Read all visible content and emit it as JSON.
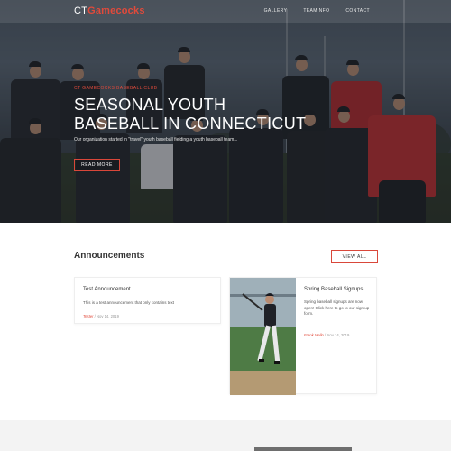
{
  "brand": {
    "prefix": "CT",
    "name": "Gamecocks"
  },
  "nav": {
    "links": [
      "GALLERY",
      "TEAMINFO",
      "CONTACT"
    ]
  },
  "hero": {
    "kicker": "CT GAMECOCKS BASEBALL CLUB",
    "title": "SEASONAL YOUTH BASEBALL IN CONNECTICUT",
    "description": "Our organization started in \"travel\" youth baseball fielding a youth baseball team...",
    "cta": "READ MORE"
  },
  "announcements": {
    "heading": "Announcements",
    "view_all": "VIEW ALL",
    "items": [
      {
        "title": "Test Announcement",
        "body": "This is a test announcement that only contains text",
        "author": "Tester",
        "date": "Nov 14, 2019"
      },
      {
        "title": "Spring Baseball Signups",
        "body": "Spring baseball signups are now open! Click here to go to our sign up form.",
        "author": "Frank Mello",
        "date": "Nov 14, 2019"
      }
    ]
  },
  "colors": {
    "accent": "#e14a3b",
    "hero_overlay": "#191c22"
  }
}
